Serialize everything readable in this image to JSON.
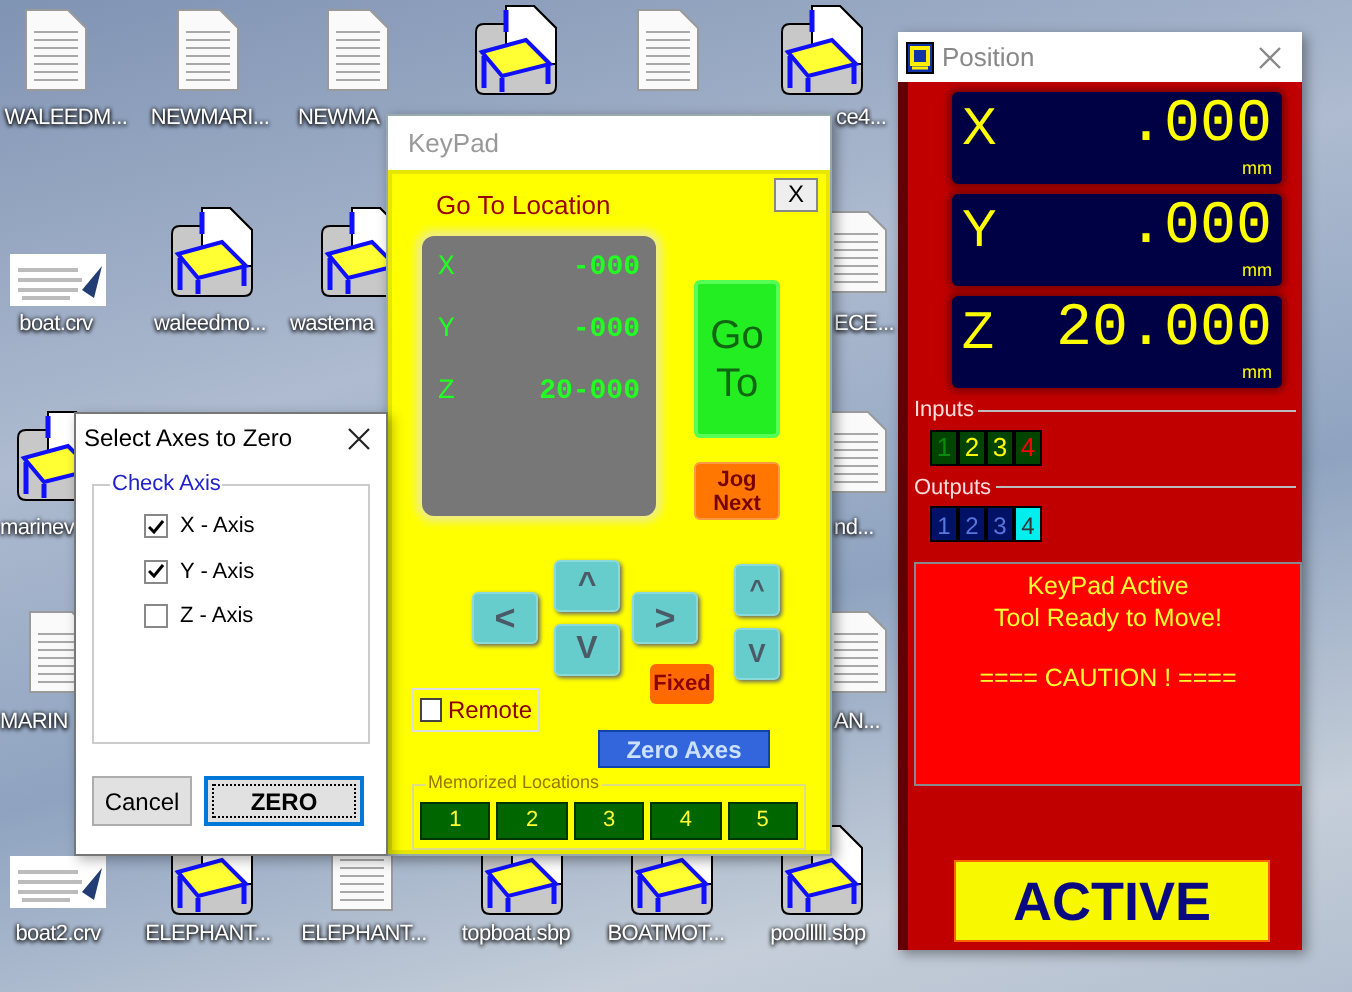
{
  "desktop": {
    "icons": [
      {
        "kind": "document",
        "label": "WALEEDM..."
      },
      {
        "kind": "document",
        "label": "NEWMARI..."
      },
      {
        "kind": "document",
        "label": "NEWMA"
      },
      {
        "kind": "machine"
      },
      {
        "kind": "document"
      },
      {
        "kind": "machine",
        "label": "ce4..."
      },
      {
        "kind": "drawing",
        "label": "boat.crv"
      },
      {
        "kind": "machine",
        "label": "waleedmo..."
      },
      {
        "kind": "machine",
        "label": "wastema"
      },
      {
        "kind": "document",
        "label": "ECE..."
      },
      {
        "kind": "machine",
        "label": "marinev"
      },
      {
        "kind": "document",
        "label": "nd..."
      },
      {
        "kind": "document",
        "label": "MARIN"
      },
      {
        "kind": "document",
        "label": "AN..."
      },
      {
        "kind": "drawing",
        "label": "boat2.crv"
      },
      {
        "kind": "machine",
        "label": "ELEPHANT..."
      },
      {
        "kind": "document",
        "label": "ELEPHANT..."
      },
      {
        "kind": "machine",
        "label": "topboat.sbp"
      },
      {
        "kind": "machine",
        "label": "BOATMOT..."
      },
      {
        "kind": "machine",
        "label": "poolllll.sbp"
      }
    ]
  },
  "keypad": {
    "title": "KeyPad",
    "close_label": "X",
    "heading": "Go To Location",
    "readout": [
      {
        "axis": "X",
        "value": "-000"
      },
      {
        "axis": "Y",
        "value": "-000"
      },
      {
        "axis": "Z",
        "value": "20-000"
      }
    ],
    "goto_button": [
      "Go",
      "To"
    ],
    "jog_button": [
      "Jog",
      "Next"
    ],
    "arrows": {
      "left": "<",
      "up": "^",
      "down": "V",
      "right": ">",
      "z_up": "^",
      "z_down": "V"
    },
    "fixed_button": "Fixed",
    "remote": {
      "label": "Remote",
      "checked": false
    },
    "zero_axes_button": "Zero Axes",
    "memorized": {
      "label": "Memorized Locations",
      "buttons": [
        "1",
        "2",
        "3",
        "4",
        "5"
      ]
    }
  },
  "position": {
    "title": "Position",
    "axes": [
      {
        "axis": "X",
        "value": ".000",
        "unit": "mm"
      },
      {
        "axis": "Y",
        "value": ".000",
        "unit": "mm"
      },
      {
        "axis": "Z",
        "value": "20.000",
        "unit": "mm"
      }
    ],
    "inputs": {
      "label": "Inputs",
      "items": [
        {
          "label": "1",
          "on": false,
          "alert": false
        },
        {
          "label": "2",
          "on": true,
          "alert": false
        },
        {
          "label": "3",
          "on": true,
          "alert": false
        },
        {
          "label": "4",
          "on": false,
          "alert": true
        }
      ]
    },
    "outputs": {
      "label": "Outputs",
      "items": [
        {
          "label": "1",
          "on": false
        },
        {
          "label": "2",
          "on": false
        },
        {
          "label": "3",
          "on": false
        },
        {
          "label": "4",
          "on": true
        }
      ]
    },
    "message": [
      [
        "KeyPad Active",
        "Tool Ready to Move!"
      ],
      [
        "==== CAUTION ! ===="
      ]
    ],
    "status_button": "ACTIVE"
  },
  "dialog": {
    "title": "Select Axes to Zero",
    "group": "Check Axis",
    "options": [
      {
        "label": "X - Axis",
        "checked": true
      },
      {
        "label": "Y - Axis",
        "checked": true
      },
      {
        "label": "Z - Axis",
        "checked": false
      }
    ],
    "buttons": [
      {
        "label": "Cancel",
        "default": false
      },
      {
        "label": "ZERO",
        "default": true
      }
    ]
  }
}
